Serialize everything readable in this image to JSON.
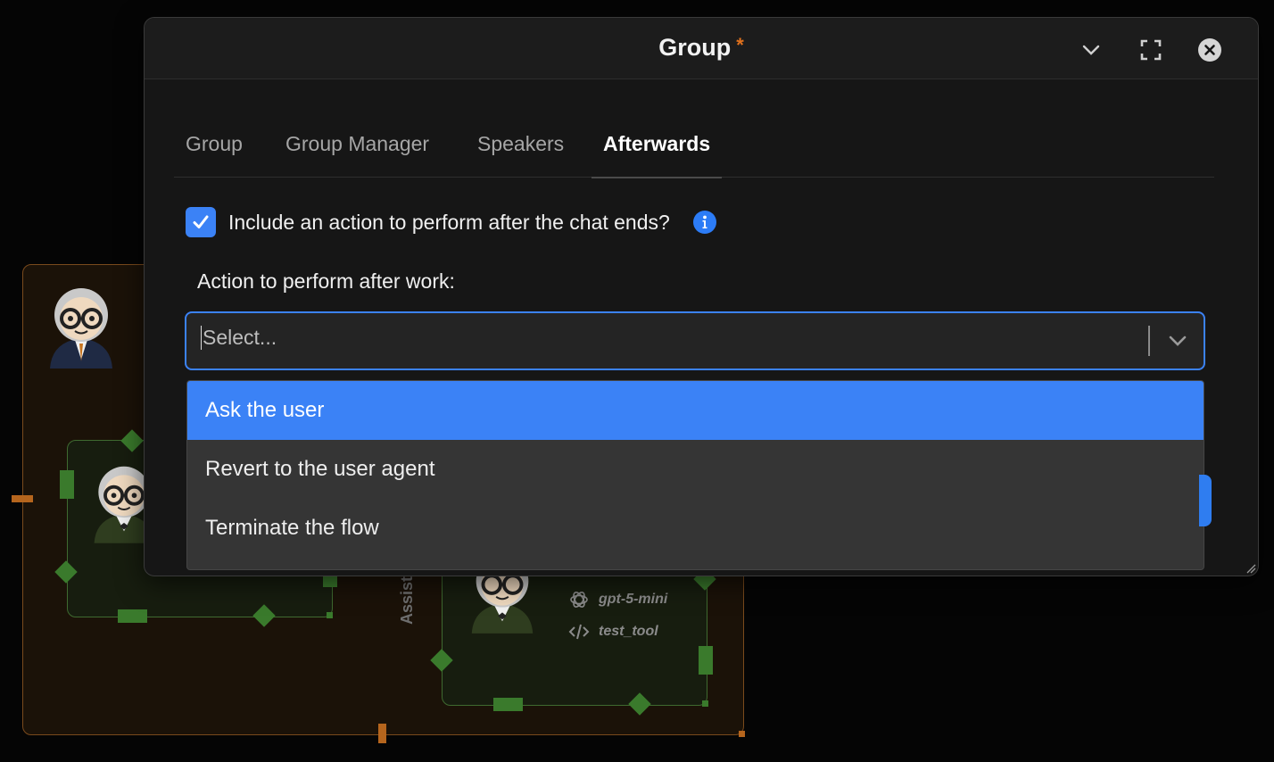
{
  "canvas": {
    "agent_label": "Assistant",
    "agent_model": "gpt-5-mini",
    "agent_tool": "test_tool"
  },
  "modal": {
    "title": "Group",
    "unsaved_marker": "*",
    "tabs": [
      {
        "label": "Group",
        "active": false
      },
      {
        "label": "Group Manager",
        "active": false
      },
      {
        "label": "Speakers",
        "active": false
      },
      {
        "label": "Afterwards",
        "active": true
      }
    ],
    "include_action": {
      "label": "Include an action to perform after the chat ends?",
      "checked": true
    },
    "action_field": {
      "label": "Action to perform after work:",
      "placeholder": "Select..."
    },
    "options": [
      {
        "label": "Ask the user",
        "highlighted": true
      },
      {
        "label": "Revert to the user agent",
        "highlighted": false
      },
      {
        "label": "Terminate the flow",
        "highlighted": false
      }
    ]
  },
  "colors": {
    "accent": "#3b82f6",
    "unsaved": "#e0711d",
    "group_border": "#7a4a1c",
    "agent_handle": "#3a7a2c"
  }
}
